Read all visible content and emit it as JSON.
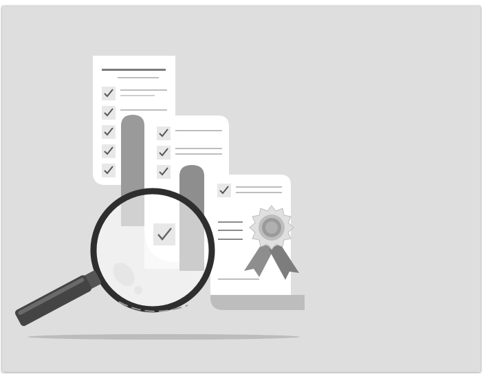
{
  "illustration": {
    "subject": "document-review-with-magnifying-glass",
    "colors": {
      "background": "#dedede",
      "paper": "#ffffff",
      "paper_shadow": "#bdbdbd",
      "fold": "#9a9a9a",
      "lines": "#b8b8b8",
      "title_line": "#7a7a7a",
      "check": "#555555",
      "check_box": "#e6e6e6",
      "ribbon": "#8e8e8e",
      "seal_outer": "#cfcfcf",
      "seal_inner": "#9a9a9a",
      "lens_rim": "#2e2e2e",
      "handle": "#444444",
      "floor_shadow": "#bcbcbc"
    },
    "icons": [
      "check-icon",
      "award-seal-icon",
      "magnifying-glass-icon"
    ]
  }
}
